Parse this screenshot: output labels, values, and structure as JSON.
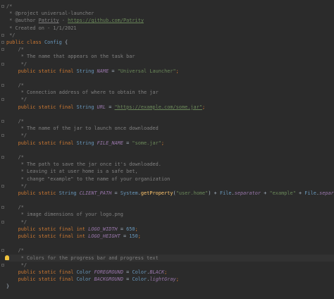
{
  "editor": {
    "lines": [
      {
        "fold": true,
        "segments": [
          [
            "c",
            "/*"
          ]
        ]
      },
      {
        "segments": [
          [
            "c",
            " * @project universal-launcher"
          ]
        ]
      },
      {
        "segments": [
          [
            "c",
            " * @author "
          ],
          [
            "cu",
            "Patrity"
          ],
          [
            "c",
            " - "
          ],
          [
            "ch",
            "https://github.com/Patrity"
          ]
        ]
      },
      {
        "segments": [
          [
            "c",
            " * Created on - 1/1/2021"
          ]
        ]
      },
      {
        "fold": true,
        "segments": [
          [
            "c",
            " */"
          ]
        ]
      },
      {
        "fold": true,
        "segments": [
          [
            "k",
            "public class "
          ],
          [
            "cls",
            "Config"
          ],
          [
            "p",
            " {"
          ]
        ]
      },
      {
        "fold": true,
        "segments": [
          [
            "c",
            "    /*"
          ]
        ]
      },
      {
        "segments": [
          [
            "c",
            "     * The name that appears on the task bar"
          ]
        ]
      },
      {
        "fold": true,
        "segments": [
          [
            "c",
            "     */"
          ]
        ]
      },
      {
        "segments": [
          [
            "k",
            "    public static final "
          ],
          [
            "t",
            "String "
          ],
          [
            "f",
            "NAME"
          ],
          [
            "p",
            " = "
          ],
          [
            "s",
            "\"Universal Launcher\""
          ],
          [
            "k",
            ";"
          ]
        ]
      },
      {
        "segments": [
          [
            "p",
            ""
          ]
        ]
      },
      {
        "fold": true,
        "segments": [
          [
            "c",
            "    /*"
          ]
        ]
      },
      {
        "segments": [
          [
            "c",
            "     * Connection address of where to obtain the jar"
          ]
        ]
      },
      {
        "fold": true,
        "segments": [
          [
            "c",
            "     */"
          ]
        ]
      },
      {
        "segments": [
          [
            "k",
            "    public static final "
          ],
          [
            "t",
            "String "
          ],
          [
            "f",
            "URL"
          ],
          [
            "p",
            " = "
          ],
          [
            "ch",
            "\"https://example.com/some.jar\""
          ],
          [
            "k",
            ";"
          ]
        ]
      },
      {
        "segments": [
          [
            "p",
            ""
          ]
        ]
      },
      {
        "fold": true,
        "segments": [
          [
            "c",
            "    /*"
          ]
        ]
      },
      {
        "segments": [
          [
            "c",
            "     * The name of the jar to launch once downloaded"
          ]
        ]
      },
      {
        "fold": true,
        "segments": [
          [
            "c",
            "     */"
          ]
        ]
      },
      {
        "segments": [
          [
            "k",
            "    public static final "
          ],
          [
            "t",
            "String "
          ],
          [
            "f",
            "FILE_NAME"
          ],
          [
            "p",
            " = "
          ],
          [
            "s",
            "\"some.jar\""
          ],
          [
            "k",
            ";"
          ]
        ]
      },
      {
        "segments": [
          [
            "p",
            ""
          ]
        ]
      },
      {
        "fold": true,
        "segments": [
          [
            "c",
            "    /*"
          ]
        ]
      },
      {
        "segments": [
          [
            "c",
            "     * The path to save the jar once it's downloaded."
          ]
        ]
      },
      {
        "segments": [
          [
            "c",
            "     * Leaving it at user home is a safe bet,"
          ]
        ]
      },
      {
        "segments": [
          [
            "c",
            "     * change \"example\" to the name of your organization"
          ]
        ]
      },
      {
        "fold": true,
        "segments": [
          [
            "c",
            "     */"
          ]
        ]
      },
      {
        "segments": [
          [
            "k",
            "    public static "
          ],
          [
            "t",
            "String "
          ],
          [
            "f",
            "CLIENT_PATH"
          ],
          [
            "p",
            " = "
          ],
          [
            "cls",
            "System"
          ],
          [
            "p",
            "."
          ],
          [
            "m",
            "getProperty"
          ],
          [
            "p",
            "("
          ],
          [
            "s",
            "\"user.home\""
          ],
          [
            "p",
            ") + "
          ],
          [
            "cls",
            "File"
          ],
          [
            "p",
            "."
          ],
          [
            "sf",
            "separator"
          ],
          [
            "p",
            " + "
          ],
          [
            "s",
            "\"example\""
          ],
          [
            "p",
            " + "
          ],
          [
            "cls",
            "File"
          ],
          [
            "p",
            "."
          ],
          [
            "sf",
            "separator"
          ],
          [
            "k",
            ";"
          ]
        ]
      },
      {
        "segments": [
          [
            "p",
            ""
          ]
        ]
      },
      {
        "fold": true,
        "segments": [
          [
            "c",
            "    /*"
          ]
        ]
      },
      {
        "segments": [
          [
            "c",
            "     * image dimensions of your logo.png"
          ]
        ]
      },
      {
        "fold": true,
        "segments": [
          [
            "c",
            "     */"
          ]
        ]
      },
      {
        "segments": [
          [
            "k",
            "    public static final int "
          ],
          [
            "f",
            "LOGO_WIDTH"
          ],
          [
            "p",
            " = "
          ],
          [
            "n",
            "650"
          ],
          [
            "k",
            ";"
          ]
        ]
      },
      {
        "segments": [
          [
            "k",
            "    public static final int "
          ],
          [
            "f",
            "LOGO_HEIGHT"
          ],
          [
            "p",
            " = "
          ],
          [
            "n",
            "150"
          ],
          [
            "k",
            ";"
          ]
        ]
      },
      {
        "segments": [
          [
            "p",
            ""
          ]
        ]
      },
      {
        "fold": true,
        "segments": [
          [
            "c",
            "    /*"
          ]
        ]
      },
      {
        "bulb": true,
        "current": true,
        "segments": [
          [
            "c",
            "     * Colors for the progress bar and progress text"
          ]
        ]
      },
      {
        "fold": true,
        "segments": [
          [
            "c",
            "     */"
          ]
        ]
      },
      {
        "segments": [
          [
            "k",
            "    public static final "
          ],
          [
            "cls",
            "Color "
          ],
          [
            "f",
            "FOREGROUND"
          ],
          [
            "p",
            " = "
          ],
          [
            "cls",
            "Color"
          ],
          [
            "p",
            "."
          ],
          [
            "sf",
            "BLACK"
          ],
          [
            "k",
            ";"
          ]
        ]
      },
      {
        "segments": [
          [
            "k",
            "    public static final "
          ],
          [
            "cls",
            "Color "
          ],
          [
            "f",
            "BACKGROUND"
          ],
          [
            "p",
            " = "
          ],
          [
            "cls",
            "Color"
          ],
          [
            "p",
            "."
          ],
          [
            "sf",
            "lightGray"
          ],
          [
            "k",
            ";"
          ]
        ]
      },
      {
        "segments": [
          [
            "p",
            "}"
          ]
        ]
      }
    ]
  }
}
